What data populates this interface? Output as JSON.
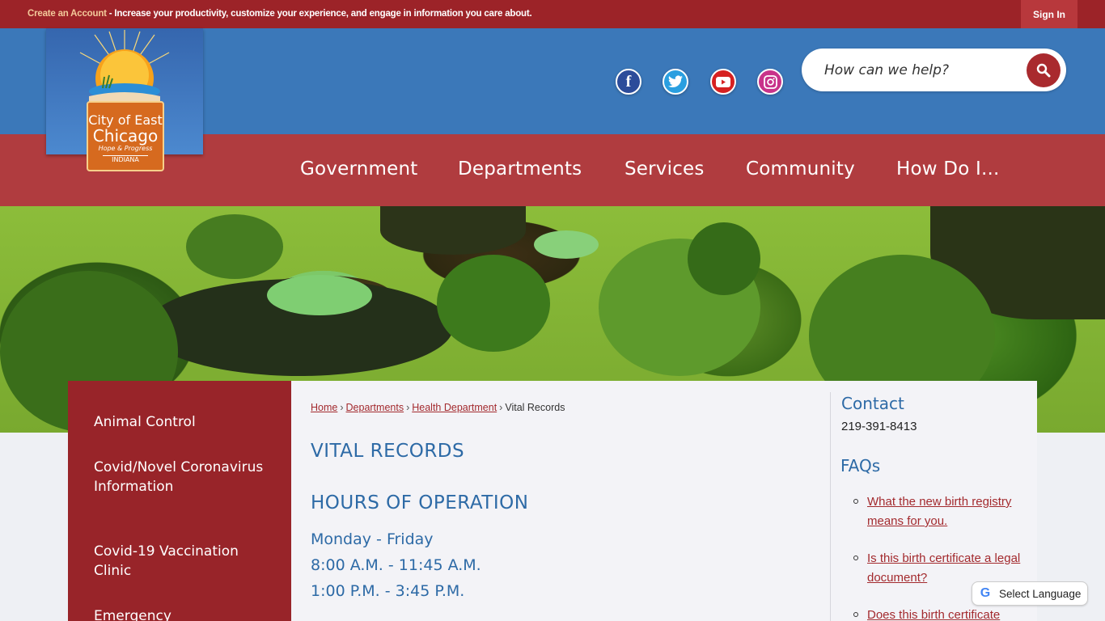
{
  "topbar": {
    "create_account": "Create an Account",
    "message": " - Increase your productivity, customize your experience, and engage in information you care about.",
    "sign_in": "Sign In"
  },
  "logo": {
    "line1": "City of East",
    "line2": "Chicago",
    "tagline": "Hope & Progress",
    "state": "INDIANA"
  },
  "social": {
    "facebook": "f",
    "twitter": "t",
    "youtube": "▶",
    "instagram": "◎"
  },
  "search": {
    "placeholder": "How can we help?"
  },
  "nav": {
    "items": [
      "Government",
      "Departments",
      "Services",
      "Community",
      "How Do I..."
    ]
  },
  "sidebar": {
    "items": [
      "Animal Control",
      "Covid/Novel Coronavirus Information",
      "Covid-19 Vaccination Clinic",
      "Emergency"
    ]
  },
  "breadcrumb": {
    "home": "Home",
    "departments": "Departments",
    "health": "Health Department",
    "current": "Vital Records",
    "separator": "›"
  },
  "content": {
    "title": "VITAL RECORDS",
    "hours_title": "HOURS OF OPERATION",
    "days": "Monday - Friday",
    "morning": "8:00 A.M. - 11:45 A.M.",
    "afternoon": "1:00 P.M. - 3:45 P.M."
  },
  "contact": {
    "title": "Contact",
    "phone": "219-391-8413"
  },
  "faqs": {
    "title": "FAQs",
    "items": [
      "What the new birth registry means for you.",
      "Is this birth certificate a legal document?",
      "Does this birth certificate"
    ]
  },
  "translate": {
    "label": "Select Language",
    "icon": "G"
  },
  "colors": {
    "topbar": "#9c2328",
    "header": "#3b78b9",
    "nav": "#b03c3f",
    "sidebar": "#982429",
    "heading": "#2d6aa6",
    "link": "#a32a2e"
  }
}
